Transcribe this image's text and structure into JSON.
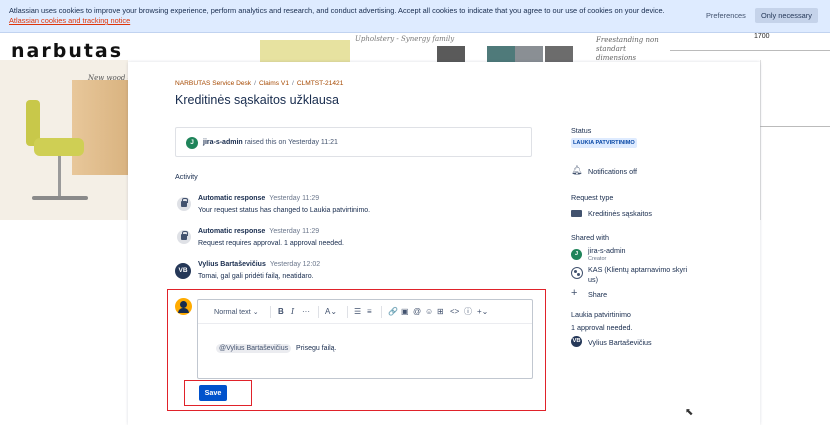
{
  "cookie_banner": {
    "text": "Atlassian uses cookies to improve your browsing experience, perform analytics and research, and conduct advertising. Accept all cookies to indicate that you agree to our use of cookies on your device.",
    "link": "Atlassian cookies and tracking notice",
    "preferences_label": "Preferences",
    "only_necessary_label": "Only necessary"
  },
  "background": {
    "logo": "narbutas",
    "handwritten_1": "New wood colour",
    "sketch_text": "Upholstery - Synergy family",
    "sketch_text_2": "Freestanding non standart dimensions",
    "number": "1700"
  },
  "breadcrumb": [
    "NARBUTAS Service Desk",
    "Claims V1",
    "CLMTST-21421"
  ],
  "page_title": "Kreditinės sąskaitos užklausa",
  "raised": {
    "avatar": "J",
    "user": "jira-s-admin",
    "text": "raised this on Yesterday 11:21"
  },
  "activity": {
    "heading": "Activity",
    "items": [
      {
        "name": "Automatic response",
        "time": "Yesterday 11:29",
        "body": "Your request status has changed to Laukia patvirtinimo."
      },
      {
        "name": "Automatic response",
        "time": "Yesterday 11:29",
        "body": "Request requires approval. 1 approval needed."
      },
      {
        "avatar": "VB",
        "name": "Vylius Bartaševičius",
        "time": "Yesterday 12:02",
        "body": "Tomai, gal gali pridėti failą, neatidaro."
      }
    ]
  },
  "editor": {
    "text_style": "Normal text",
    "mention": "@Vylius Bartaševičius",
    "body": "Prisegu failą.",
    "save_label": "Save"
  },
  "sidebar": {
    "status_heading": "Status",
    "status_value": "LAUKIA PATVIRTINIMO",
    "notifications": "Notifications off",
    "request_type_heading": "Request type",
    "request_type_value": "Kreditinės sąskaitos",
    "shared_heading": "Shared with",
    "shared_user": "jira-s-admin",
    "shared_user_role": "Creator",
    "shared_org": "KAS (Klientų aptarnavimo skyri",
    "shared_org_2": "us)",
    "share_label": "Share",
    "approval_heading": "Laukia patvirtinimo",
    "approval_needed": "1 approval needed.",
    "approver_avatar": "VB",
    "approver": "Vylius Bartaševičius"
  },
  "colors": {
    "brand_blue": "#0052cc",
    "highlight_red": "#e0222a",
    "breadcrumb": "#a54800"
  }
}
